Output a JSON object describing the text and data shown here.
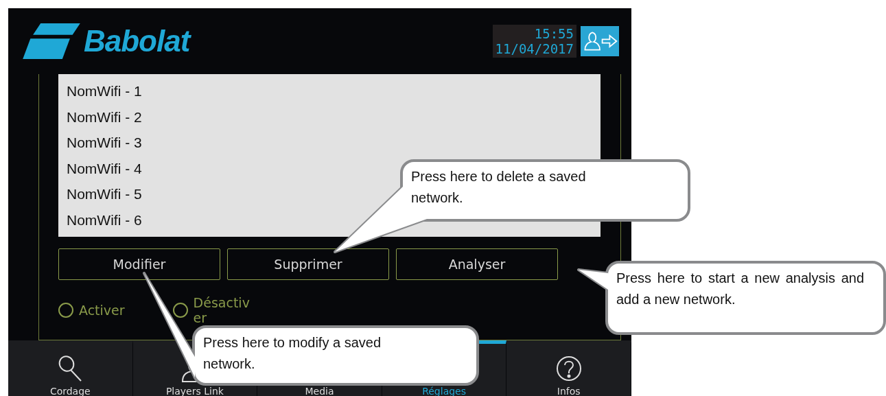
{
  "header": {
    "logo": "Babolat",
    "time": "15:55",
    "date": "11/04/2017"
  },
  "networks": [
    {
      "name": "NomWifi - 1"
    },
    {
      "name": "NomWifi - 2"
    },
    {
      "name": "NomWifi - 3"
    },
    {
      "name": "NomWifi - 4"
    },
    {
      "name": "NomWifi - 5"
    },
    {
      "name": "NomWifi - 6"
    }
  ],
  "buttons": [
    "Modifier",
    "Supprimer",
    "Analyser"
  ],
  "radios": [
    {
      "label": "Activer",
      "selected": false
    },
    {
      "label": "Désactiver",
      "selected": false
    }
  ],
  "nav": [
    {
      "label": "Cordage",
      "selected": false
    },
    {
      "label": "Players Link",
      "selected": false
    },
    {
      "label": "Media",
      "selected": false
    },
    {
      "label": "Réglages",
      "selected": true
    },
    {
      "label": "Infos",
      "selected": false
    }
  ],
  "callouts": [
    {
      "text": "Press here to delete a saved network."
    },
    {
      "text": "Press here to start a new analysis and add a new network."
    },
    {
      "text": "Press here to modify a saved network."
    }
  ]
}
